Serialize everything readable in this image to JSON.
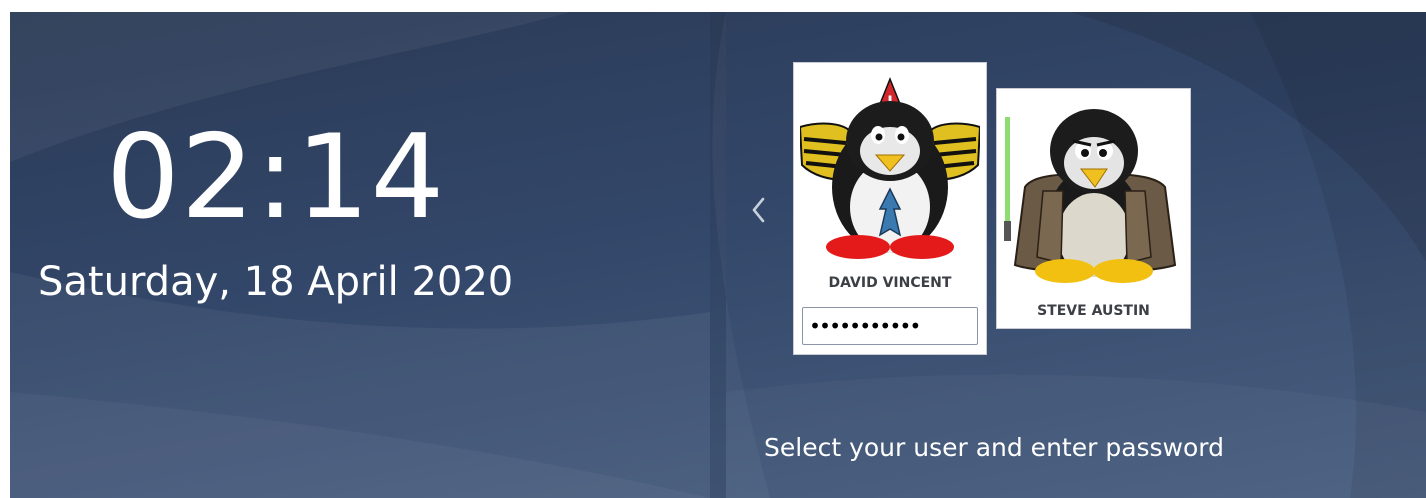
{
  "clock": {
    "time": "02:14",
    "date": "Saturday, 18 April 2020"
  },
  "users": [
    {
      "name": "DAVID VINCENT",
      "avatar_icon": "penguin-robot-icon",
      "selected": true,
      "password_value": "●●●●●●●●●●●"
    },
    {
      "name": "STEVE AUSTIN",
      "avatar_icon": "penguin-jedi-icon",
      "selected": false
    }
  ],
  "nav": {
    "prev_icon": "chevron-left-icon"
  },
  "hint": "Select your user and enter password",
  "colors": {
    "background_top": "#2a3a55",
    "background_bottom": "#4a5f80",
    "text": "#ffffff",
    "card": "#ffffff"
  }
}
